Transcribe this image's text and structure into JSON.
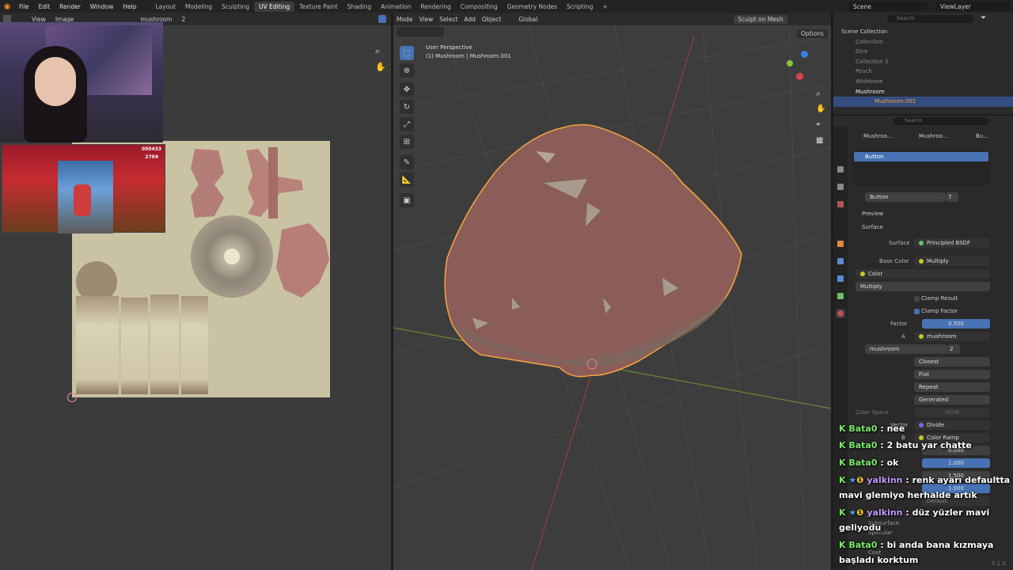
{
  "menu": {
    "items": [
      "File",
      "Edit",
      "Render",
      "Window",
      "Help"
    ],
    "workspaces": [
      "Layout",
      "Modeling",
      "Sculpting",
      "UV Editing",
      "Texture Paint",
      "Shading",
      "Animation",
      "Rendering",
      "Compositing",
      "Geometry Nodes",
      "Scripting"
    ],
    "active_workspace": "UV Editing",
    "scene": "Scene",
    "view_layer": "ViewLayer"
  },
  "uv_editor": {
    "view": "View",
    "image": "Image",
    "image_name": "mushroom",
    "image_users": "2"
  },
  "viewport": {
    "mode": "Mode",
    "menus": [
      "View",
      "Select",
      "Add",
      "Object"
    ],
    "orientation": "Global",
    "sculpt_button": "Sculpt on Mesh",
    "options": "Options",
    "perspective_label": "User Perspective",
    "object_label": "(1) Mushroom | Mushroom.001"
  },
  "outliner": {
    "search_placeholder": "Search",
    "root": "Scene Collection",
    "items": [
      "Collection",
      "Dice",
      "Collection 3",
      "Pouch",
      "Wishbone",
      "Mushroom",
      "Mushroom.001"
    ]
  },
  "properties": {
    "search_placeholder": "Search",
    "breadcrumb": [
      "Mushroo...",
      "Mushroo...",
      "Bu..."
    ],
    "material_slot": "Button",
    "material_name": "Button",
    "material_users": "7",
    "preview": "Preview",
    "surface_header": "Surface",
    "surface_label": "Surface",
    "surface_value": "Principled BSDF",
    "base_color_label": "Base Color",
    "base_color_value": "Multiply",
    "color_label": "Color",
    "blend_mode": "Multiply",
    "clamp_result": "Clamp Result",
    "clamp_factor": "Clamp Factor",
    "factor_label": "Factor",
    "factor_value": "0.500",
    "a_label": "A",
    "a_value": "mushroom",
    "image_name": "mushroom",
    "image_users": "2",
    "interpolation": "Closest",
    "projection": "Flat",
    "extension": "Repeat",
    "source": "Generated",
    "color_space_label": "Color Space",
    "color_space_value": "sRGB",
    "vector_label": "Vector",
    "vector_value": "Divide",
    "b_label": "B",
    "b_value": "Color Ramp",
    "metallic_value": "0.000",
    "roughness_value": "1.000",
    "ior_value": "1.500",
    "alpha_value": "1.000",
    "normal_value": "Default",
    "subsurface": "Subsurface",
    "specular": "Specular",
    "coat": "Coat",
    "version": "5.1.0"
  },
  "stream_overlay": {
    "game_score": "050433",
    "game_coins": "2704"
  },
  "chat": [
    {
      "user": "Bata0",
      "text": " : nee",
      "color": "#7be86a"
    },
    {
      "user": "Bata0",
      "text": " : 2 batu yar chatte",
      "color": "#7be86a"
    },
    {
      "user": "Bata0",
      "text": " : ok",
      "color": "#7be86a"
    },
    {
      "user": "yalkinn",
      "text": " : renk ayarı defaultta",
      "cont": "mavi glemiyo herhalde artık",
      "color": "#c79bff"
    },
    {
      "user": "yalkinn",
      "text": " : düz yüzler mavi",
      "cont": "geliyodu",
      "color": "#c79bff"
    },
    {
      "user": "Bata0",
      "text": " : bi anda bana kızmaya",
      "cont": "başladı korktum",
      "color": "#7be86a"
    }
  ],
  "colors": {
    "accent_blue": "#4772b3",
    "selection_orange": "#f2a041",
    "chat_green": "#7be86a",
    "chat_purple": "#c79bff"
  }
}
